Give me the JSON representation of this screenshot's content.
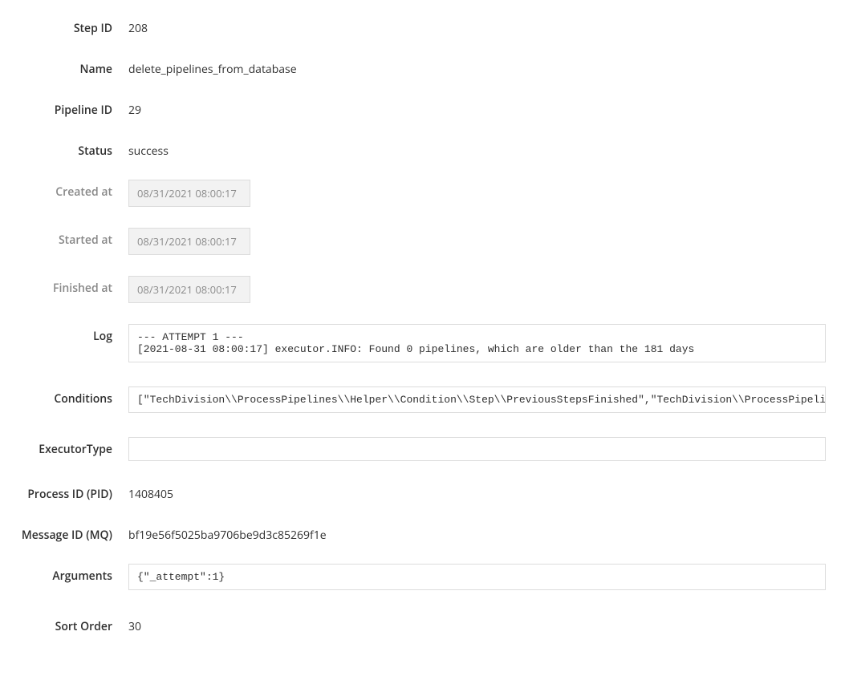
{
  "labels": {
    "step_id": "Step ID",
    "name": "Name",
    "pipeline_id": "Pipeline ID",
    "status": "Status",
    "created_at": "Created at",
    "started_at": "Started at",
    "finished_at": "Finished at",
    "log": "Log",
    "conditions": "Conditions",
    "executor_type": "ExecutorType",
    "process_id": "Process ID (PID)",
    "message_id": "Message ID (MQ)",
    "arguments": "Arguments",
    "sort_order": "Sort Order"
  },
  "values": {
    "step_id": "208",
    "name": "delete_pipelines_from_database",
    "pipeline_id": "29",
    "status": "success",
    "created_at": "08/31/2021 08:00:17",
    "started_at": "08/31/2021 08:00:17",
    "finished_at": "08/31/2021 08:00:17",
    "log": "--- ATTEMPT 1 ---\n[2021-08-31 08:00:17] executor.INFO: Found 0 pipelines, which are older than the 181 days",
    "conditions": "[\"TechDivision\\\\ProcessPipelines\\\\Helper\\\\Condition\\\\Step\\\\PreviousStepsFinished\",\"TechDivision\\\\ProcessPipelines\\\\Helper\\\\Condition\\\\Step\\\\AttemptsLimit\"]",
    "executor_type": "",
    "process_id": "1408405",
    "message_id": "bf19e56f5025ba9706be9d3c85269f1e",
    "arguments": "{\"_attempt\":1}",
    "sort_order": "30"
  }
}
